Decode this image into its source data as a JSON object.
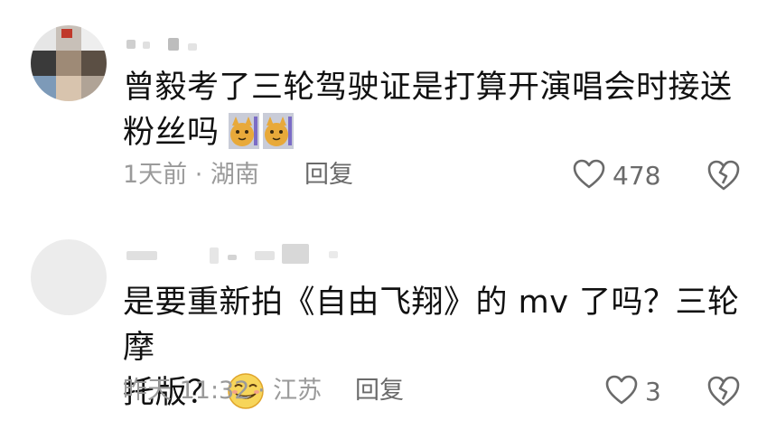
{
  "comments": [
    {
      "text_line1": "曾毅考了三轮驾驶证是打算开演唱会时接送",
      "text_line2": "粉丝吗",
      "emojis": [
        "cat-emoji",
        "cat-emoji"
      ],
      "time_location": "1天前 · 湖南",
      "reply_label": "回复",
      "like_count": "478"
    },
    {
      "text_line1": "是要重新拍《自由飞翔》的 mv 了吗？三轮摩",
      "text_line2": "托版？",
      "emojis": [
        "grinning-squint-emoji"
      ],
      "time_location": "昨天 11:32 · 江苏",
      "reply_label": "回复",
      "like_count": "3"
    }
  ],
  "icons": {
    "like": "heart-outline-icon",
    "dislike": "broken-heart-outline-icon"
  },
  "colors": {
    "text": "#111111",
    "meta": "#9a9a9a",
    "icon": "#6a6a6a"
  }
}
